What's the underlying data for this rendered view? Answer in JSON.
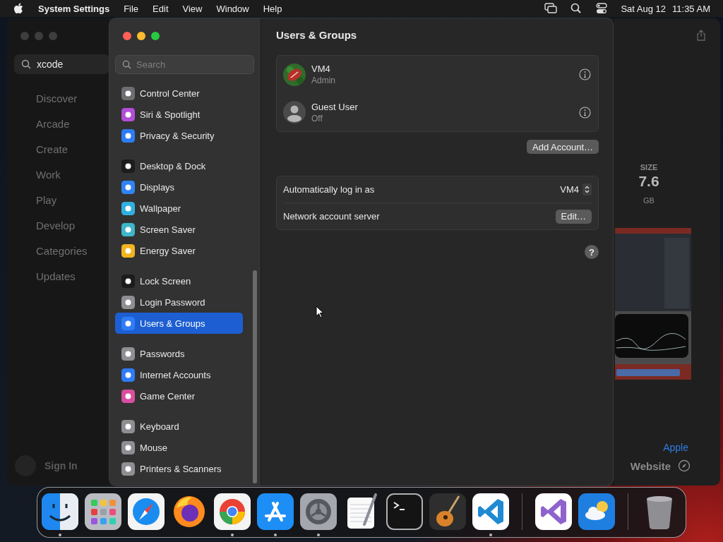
{
  "menu_bar": {
    "app_name": "System Settings",
    "menus": [
      "File",
      "Edit",
      "View",
      "Window",
      "Help"
    ],
    "date": "Sat Aug 12",
    "time": "11:35 AM"
  },
  "background_window": {
    "search": {
      "value": "xcode"
    },
    "nav_items": [
      "Discover",
      "Arcade",
      "Create",
      "Work",
      "Play",
      "Develop",
      "Categories",
      "Updates"
    ],
    "sign_in": "Sign In",
    "size_label": "SIZE",
    "size_value": "7.6",
    "size_unit": "GB",
    "developer_link": "Apple",
    "website_link": "Website"
  },
  "settings_window": {
    "search": {
      "placeholder": "Search"
    },
    "sidebar_groups": [
      {
        "items": [
          {
            "label": "Control Center",
            "color": "#6d6d72",
            "selected": false
          },
          {
            "label": "Siri & Spotlight",
            "color": "#b14fd6",
            "selected": false
          },
          {
            "label": "Privacy & Security",
            "color": "#2d7cf6",
            "selected": false
          }
        ]
      },
      {
        "items": [
          {
            "label": "Desktop & Dock",
            "color": "#1c1c1e",
            "selected": false
          },
          {
            "label": "Displays",
            "color": "#2f83f5",
            "selected": false
          },
          {
            "label": "Wallpaper",
            "color": "#30b0e0",
            "selected": false
          },
          {
            "label": "Screen Saver",
            "color": "#3fb6c9",
            "selected": false
          },
          {
            "label": "Energy Saver",
            "color": "#f2b51f",
            "selected": false
          }
        ]
      },
      {
        "items": [
          {
            "label": "Lock Screen",
            "color": "#1c1c1e",
            "selected": false
          },
          {
            "label": "Login Password",
            "color": "#8e8e93",
            "selected": false
          },
          {
            "label": "Users & Groups",
            "color": "#2f7cf6",
            "selected": true
          }
        ]
      },
      {
        "items": [
          {
            "label": "Passwords",
            "color": "#8e8e93",
            "selected": false
          },
          {
            "label": "Internet Accounts",
            "color": "#2f7cf6",
            "selected": false
          },
          {
            "label": "Game Center",
            "color": "#d94fa0",
            "selected": false
          }
        ]
      },
      {
        "items": [
          {
            "label": "Keyboard",
            "color": "#8e8e93",
            "selected": false
          },
          {
            "label": "Mouse",
            "color": "#8e8e93",
            "selected": false
          },
          {
            "label": "Printers & Scanners",
            "color": "#8e8e93",
            "selected": false
          }
        ]
      }
    ],
    "title": "Users & Groups",
    "users": [
      {
        "name": "VM4",
        "role": "Admin",
        "kind": "picture"
      },
      {
        "name": "Guest User",
        "role": "Off",
        "kind": "guest"
      }
    ],
    "add_button": "Add Account…",
    "options": [
      {
        "kind": "popup",
        "label": "Automatically log in as",
        "value": "VM4"
      },
      {
        "kind": "button",
        "label": "Network account server",
        "value": "Edit…"
      }
    ],
    "help": "?"
  },
  "dock": {
    "sections": [
      [
        {
          "kind": "finder",
          "running": true
        },
        {
          "kind": "launchpad",
          "running": false
        },
        {
          "kind": "safari",
          "running": false
        },
        {
          "kind": "firefox",
          "running": false
        },
        {
          "kind": "chrome",
          "running": true
        },
        {
          "kind": "appstore",
          "running": true
        },
        {
          "kind": "settings",
          "running": true
        },
        {
          "kind": "textedit",
          "running": false
        },
        {
          "kind": "terminal",
          "running": false
        },
        {
          "kind": "garageband",
          "running": false
        },
        {
          "kind": "vscode",
          "running": true
        }
      ],
      [
        {
          "kind": "visualstudio",
          "running": false
        },
        {
          "kind": "weather",
          "running": false
        }
      ],
      [
        {
          "kind": "trash",
          "running": false
        }
      ]
    ]
  }
}
